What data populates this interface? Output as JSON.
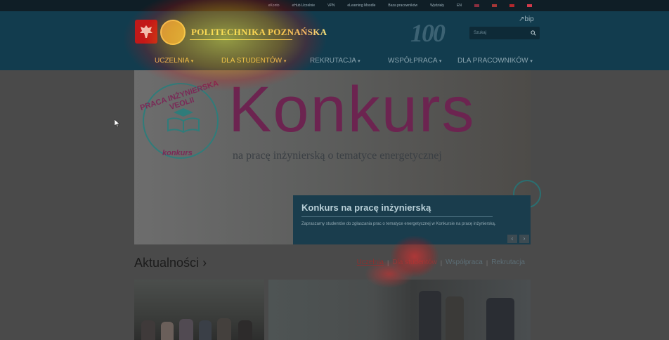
{
  "topbar": {
    "links": [
      "eKonto",
      "eHub.Uczelnie",
      "VPN",
      "eLearning Moodle",
      "Baza pracowników",
      "Wydziały",
      "EN"
    ],
    "flag_colors": [
      "#8b2f3f",
      "#a43737",
      "#b3282d",
      "#d23b4c"
    ]
  },
  "header": {
    "logo_text": "POLITECHNIKA POZNAŃSKA",
    "anniversary_mark": "100",
    "bip_label": "bip",
    "search_placeholder": "Szukaj",
    "search_icon": "magnifier-icon"
  },
  "nav": {
    "items": [
      {
        "label": "UCZELNIA",
        "caret": "▾"
      },
      {
        "label": "DLA STUDENTÓW",
        "caret": "▾"
      },
      {
        "label": "REKRUTACJA",
        "caret": "▾"
      },
      {
        "label": "WSPÓŁPRACA",
        "caret": "▾"
      },
      {
        "label": "DLA PRACOWNIKÓW",
        "caret": "▾"
      }
    ]
  },
  "hero": {
    "badge_top": "PRACA INŻYNIERSKA VEOLII",
    "badge_bottom": "konkurs",
    "headline": "Konkurs",
    "subheadline": "na pracę inżynierską o tematyce energetycznej",
    "caption_title": "Konkurs na pracę inżynierską",
    "caption_text": "Zapraszamy studentów do zgłaszania prac o tematyce energetycznej w Konkursie na pracę inżynierską.",
    "prev_arrow": "‹",
    "next_arrow": "›"
  },
  "news": {
    "heading": "Aktualności",
    "heading_arrow": "›",
    "tabs": [
      "Uczelnia",
      "Dla studentów",
      "Współpraca",
      "Rekrutacja"
    ],
    "separator": "|"
  },
  "colors": {
    "header_bg": "#123c4e",
    "topbar_bg": "#0f1e26",
    "logo_gold": "#f6e27a",
    "brand_purple": "#6c2450",
    "caption_bg": "#1a3d4d"
  }
}
